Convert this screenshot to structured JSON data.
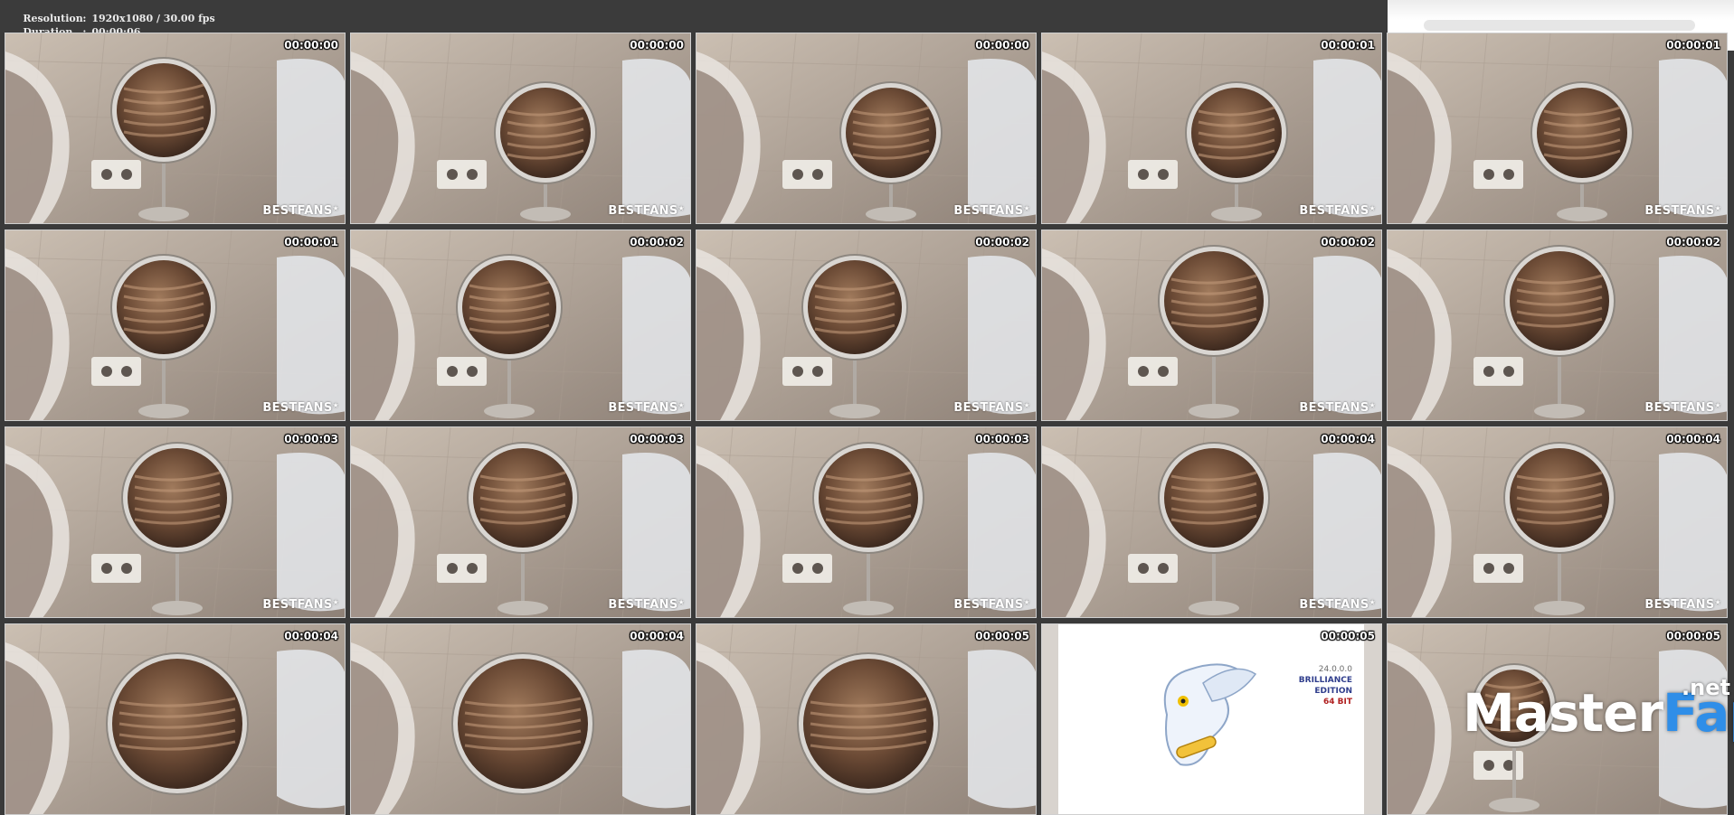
{
  "header": {
    "resolution_label": "Resolution",
    "resolution_value": "1920x1080 / 30.00 fps",
    "duration_label": "Duration",
    "duration_value": "00:00:06",
    "separator": ":"
  },
  "thumbnails": [
    {
      "timestamp": "00:00:00",
      "watermark": "BESTFANS",
      "variant": "a"
    },
    {
      "timestamp": "00:00:00",
      "watermark": "BESTFANS",
      "variant": "b"
    },
    {
      "timestamp": "00:00:00",
      "watermark": "BESTFANS",
      "variant": "b"
    },
    {
      "timestamp": "00:00:01",
      "watermark": "BESTFANS",
      "variant": "b"
    },
    {
      "timestamp": "00:00:01",
      "watermark": "BESTFANS",
      "variant": "b"
    },
    {
      "timestamp": "00:00:01",
      "watermark": "BESTFANS",
      "variant": "a"
    },
    {
      "timestamp": "00:00:02",
      "watermark": "BESTFANS",
      "variant": "a"
    },
    {
      "timestamp": "00:00:02",
      "watermark": "BESTFANS",
      "variant": "a"
    },
    {
      "timestamp": "00:00:02",
      "watermark": "BESTFANS",
      "variant": "c"
    },
    {
      "timestamp": "00:00:02",
      "watermark": "BESTFANS",
      "variant": "c"
    },
    {
      "timestamp": "00:00:03",
      "watermark": "BESTFANS",
      "variant": "c"
    },
    {
      "timestamp": "00:00:03",
      "watermark": "BESTFANS",
      "variant": "c"
    },
    {
      "timestamp": "00:00:03",
      "watermark": "BESTFANS",
      "variant": "c"
    },
    {
      "timestamp": "00:00:04",
      "watermark": "BESTFANS",
      "variant": "c"
    },
    {
      "timestamp": "00:00:04",
      "watermark": "BESTFANS",
      "variant": "c"
    },
    {
      "timestamp": "00:00:04",
      "watermark": "",
      "variant": "d"
    },
    {
      "timestamp": "00:00:04",
      "watermark": "",
      "variant": "d"
    },
    {
      "timestamp": "00:00:05",
      "watermark": "",
      "variant": "d"
    },
    {
      "timestamp": "00:00:05",
      "watermark": "",
      "variant": "installer"
    },
    {
      "timestamp": "00:00:05",
      "watermark": "",
      "variant": "e"
    }
  ],
  "installer": {
    "version": "24.0.0.0",
    "edition_line1": "BRILLIANCE",
    "edition_line2": "EDITION",
    "bits": "64 BIT",
    "icon": "owl-icon"
  },
  "branding": {
    "main": "Master",
    "accent": "Fap",
    "tld": ".net",
    "accent_color": "#2f8ee8"
  }
}
